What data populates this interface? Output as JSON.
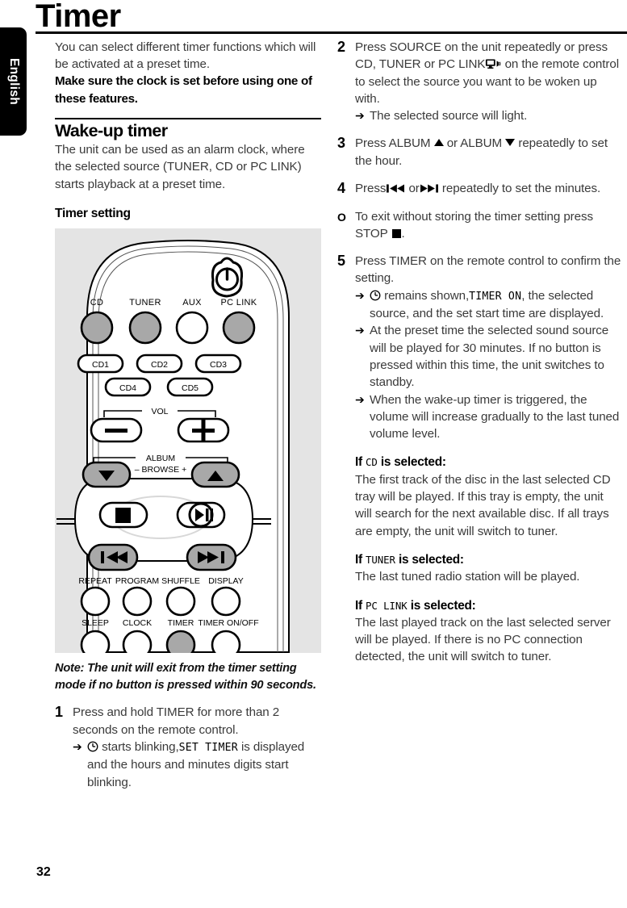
{
  "page": {
    "title": "Timer",
    "number": "32",
    "language_tab": "English"
  },
  "left_column": {
    "intro_plain": "You can select different timer functions which will be activated at a preset time.",
    "intro_bold": "Make sure the clock is set before using one of these features.",
    "section_heading": "Wake-up timer",
    "section_text": "The unit can be used as an alarm clock, where the selected source (TUNER, CD or PC LINK) starts playback at a preset time.",
    "sub_heading": "Timer setting",
    "note": "Note: The unit will exit from the timer setting mode if no button is pressed within 90 seconds.",
    "step1": {
      "number": "1",
      "text": "Press and hold TIMER for more than 2 seconds on the remote control.",
      "result_prefix": "starts blinking,",
      "result_mono": "SET TIMER",
      "result_suffix": "is displayed and the hours and minutes digits start blinking."
    }
  },
  "remote": {
    "power_label": "power-button",
    "source_buttons": [
      "CD",
      "TUNER",
      "AUX",
      "PC LINK"
    ],
    "source_filled": [
      true,
      true,
      false,
      true
    ],
    "disc_buttons_row1": [
      "CD1",
      "CD2",
      "CD3"
    ],
    "disc_buttons_row2": [
      "CD4",
      "CD5"
    ],
    "volume_label": "VOL",
    "volume_minus": "–",
    "volume_plus": "+",
    "album_label": "ALBUM",
    "browse_label": "– BROWSE +",
    "function_row1": [
      "REPEAT",
      "PROGRAM",
      "SHUFFLE",
      "DISPLAY"
    ],
    "function_row2": [
      "SLEEP",
      "CLOCK",
      "TIMER",
      "TIMER ON/OFF"
    ],
    "function_row2_filled": [
      false,
      false,
      true,
      false
    ]
  },
  "right_column": {
    "step2": {
      "number": "2",
      "text_a": "Press SOURCE on the unit repeatedly or press CD, TUNER or PC LINK",
      "text_b": "on the remote control to select the source you want to be woken up with.",
      "result": "The selected source will light."
    },
    "step3": {
      "number": "3",
      "text_a": "Press ALBUM",
      "text_b": "or ALBUM",
      "text_c": "repeatedly to set the hour."
    },
    "step4": {
      "number": "4",
      "text_a": "Press",
      "text_b": "or",
      "text_c": "repeatedly to set the minutes."
    },
    "bullet": {
      "marker": "O",
      "text_a": "To exit without storing the timer setting press STOP",
      "text_b": "."
    },
    "step5": {
      "number": "5",
      "text": "Press TIMER on the remote control to confirm the setting.",
      "result1_prefix": "remains shown,",
      "result1_mono": "TIMER ON",
      "result1_suffix": ", the selected source, and the set start time are displayed.",
      "result2": "At the preset time the selected sound source will be played for 30 minutes. If no button is pressed within this time, the unit switches to standby.",
      "result3": "When the wake-up timer is triggered, the volume will increase gradually to the last tuned volume level."
    },
    "conditions": [
      {
        "if_word": "If",
        "source": "CD",
        "selected_word": "is selected:",
        "body": "The first track of the disc in the last selected CD tray will be played. If this tray is empty, the unit will search for the next available disc. If all trays are empty, the unit will switch to tuner."
      },
      {
        "if_word": "If",
        "source": "TUNER",
        "selected_word": "is selected:",
        "body": "The last tuned radio station will be played."
      },
      {
        "if_word": "If",
        "source": "PC LINK",
        "selected_word": "is selected:",
        "body": "The last played track on the last selected server will be played. If there is no PC connection detected, the unit will switch to tuner."
      }
    ]
  },
  "colors": {
    "figure_background": "#e4e4e4",
    "button_fill": "#a8a8a8",
    "text_body": "#3a3a3a",
    "text_heading": "#000000"
  }
}
